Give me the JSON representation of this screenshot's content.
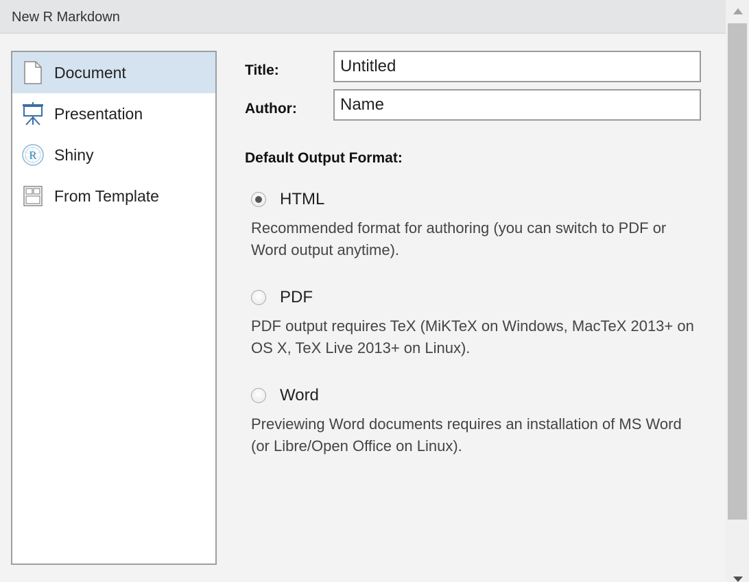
{
  "window": {
    "title": "New R Markdown"
  },
  "sidebar": {
    "items": [
      {
        "label": "Document",
        "icon": "document-icon",
        "selected": true
      },
      {
        "label": "Presentation",
        "icon": "presentation-icon",
        "selected": false
      },
      {
        "label": "Shiny",
        "icon": "shiny-icon",
        "selected": false
      },
      {
        "label": "From Template",
        "icon": "template-icon",
        "selected": false
      }
    ]
  },
  "form": {
    "title_label": "Title:",
    "title_value": "Untitled",
    "author_label": "Author:",
    "author_value": "Name",
    "output_label": "Default Output Format:"
  },
  "formats": [
    {
      "label": "HTML",
      "checked": true,
      "description": "Recommended format for authoring (you can switch to PDF or Word output anytime)."
    },
    {
      "label": "PDF",
      "checked": false,
      "description": "PDF output requires TeX (MiKTeX on Windows, MacTeX 2013+ on OS X, TeX Live 2013+ on Linux)."
    },
    {
      "label": "Word",
      "checked": false,
      "description": "Previewing Word documents requires an installation of MS Word (or Libre/Open Office on Linux)."
    }
  ],
  "colors": {
    "selection": "#d5e3f0",
    "accent": "#3b6fa3"
  }
}
